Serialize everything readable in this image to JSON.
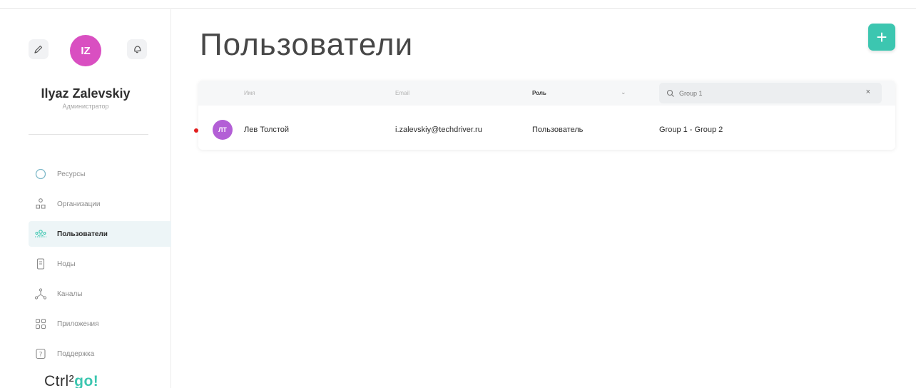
{
  "profile": {
    "initials": "IZ",
    "name": "Ilyaz Zalevskiy",
    "role": "Администратор",
    "avatar_color": "#d94fc1"
  },
  "sidebar": {
    "items": [
      {
        "label": "Ресурсы",
        "icon": "circle-icon",
        "active": false
      },
      {
        "label": "Организации",
        "icon": "org-tree-icon",
        "active": false
      },
      {
        "label": "Пользователи",
        "icon": "users-icon",
        "active": true
      },
      {
        "label": "Ноды",
        "icon": "server-icon",
        "active": false
      },
      {
        "label": "Каналы",
        "icon": "channels-icon",
        "active": false
      },
      {
        "label": "Приложения",
        "icon": "apps-grid-icon",
        "active": false
      },
      {
        "label": "Поддержка",
        "icon": "help-icon",
        "active": false
      }
    ]
  },
  "brand": {
    "prefix": "Ctrl²",
    "suffix": "go!"
  },
  "page": {
    "title": "Пользователи",
    "add_label": "+"
  },
  "table": {
    "headers": {
      "name": "Имя",
      "email": "Email",
      "role": "Роль"
    },
    "search": {
      "value": "Group 1",
      "clear": "×"
    },
    "rows": [
      {
        "initials": "ЛТ",
        "name": "Лев Толстой",
        "email": "i.zalevskiy@techdriver.ru",
        "role": "Пользователь",
        "groups": "Group 1 - Group 2"
      }
    ]
  },
  "colors": {
    "accent": "#3cc6b0",
    "status_dot": "#e21e1e",
    "row_avatar": "#b35fd6"
  }
}
